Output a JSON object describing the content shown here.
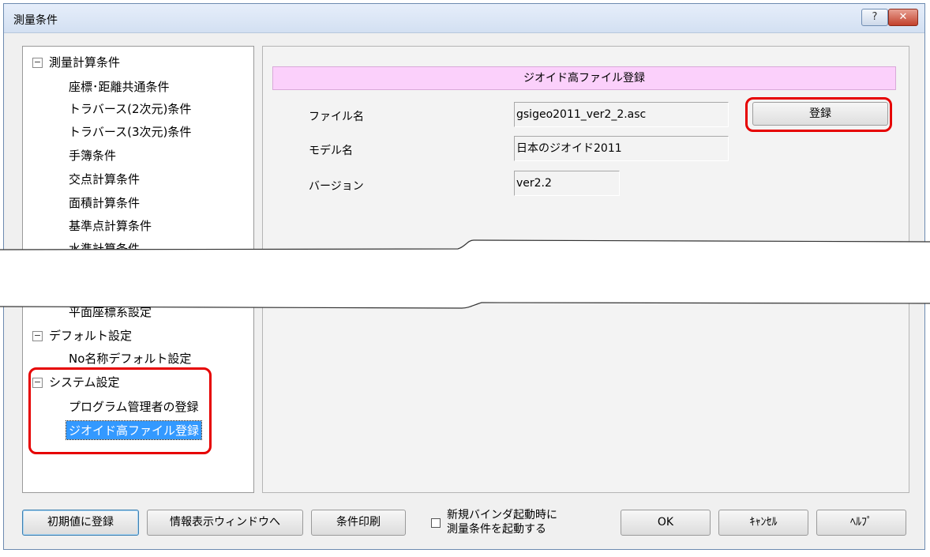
{
  "window": {
    "title": "測量条件",
    "help_label": "?",
    "close_label": "✕"
  },
  "tree": {
    "categories": [
      {
        "label": "測量計算条件",
        "toggle": "⊟"
      },
      {
        "label": "デフォルト設定",
        "toggle": "⊟"
      },
      {
        "label": "システム設定",
        "toggle": "⊟"
      }
    ],
    "items": [
      "座標･距離共通条件",
      "トラバース(2次元)条件",
      "トラバース(3次元)条件",
      "手簿条件",
      "交点計算条件",
      "面積計算条件",
      "基準点計算条件",
      "水準計算条件",
      "平面座標系設定",
      "No名称デフォルト設定",
      "プログラム管理者の登録",
      "ジオイド高ファイル登録"
    ],
    "selected_index": 11
  },
  "panel": {
    "header": "ジオイド高ファイル登録",
    "file_label": "ファイル名",
    "file_value": "gsigeo2011_ver2_2.asc",
    "register_button": "登録",
    "model_label": "モデル名",
    "model_value": "日本のジオイド2011",
    "version_label": "バージョン",
    "version_value": "ver2.2"
  },
  "footer": {
    "init_button": "初期値に登録",
    "info_button": "情報表示ウィンドウへ",
    "print_button": "条件印刷",
    "checkbox_line1": "新規バインダ起動時に",
    "checkbox_line2": "測量条件を起動する",
    "checkbox_checked": false,
    "ok_button": "OK",
    "cancel_button": "ｷｬﾝｾﾙ",
    "help_button": "ﾍﾙﾌﾟ"
  },
  "colors": {
    "header_bg": "#fbd0fb",
    "selected_bg": "#3399ff",
    "highlight": "#e60000",
    "close_btn": "#c2412c"
  }
}
